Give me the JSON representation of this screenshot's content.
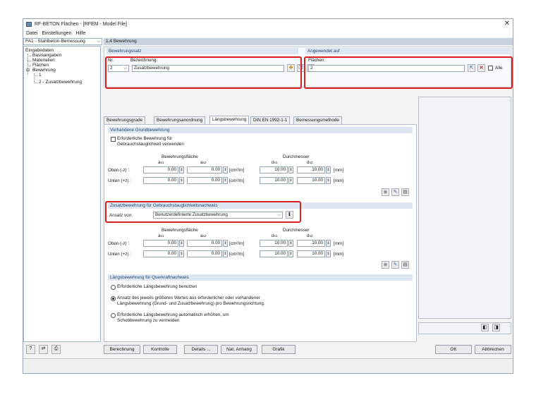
{
  "window": {
    "title": "RF-BETON Flächen - [RFEM - Model File]"
  },
  "menu": [
    "Datei",
    "Einstellungen",
    "Hilfe"
  ],
  "nav": {
    "case": "FA1 - Stahlbeton-Bemessung",
    "items": [
      "Eingabedaten",
      "Basisangaben",
      "Materialien",
      "Flächen",
      "Bewehrung",
      "1",
      "2 - Zusatzbewehrung"
    ]
  },
  "page_title": "1.4 Bewehrung",
  "bewehrungssatz": {
    "title": "Bewehrungssatz",
    "nr_label": "Nr.",
    "nr_value": "2",
    "bez_label": "Bezeichnung:",
    "bez_value": "Zusatzbewehrung"
  },
  "angewendet": {
    "title": "Angewendet auf",
    "flaechen_label": "Flächen:",
    "flaechen_value": "2",
    "alle_label": "Alle"
  },
  "tabs": [
    "Bewehrungsgrade",
    "Bewehrungsanordnung",
    "Längsbewehrung",
    "DIN EN 1992-1-1",
    "Bemessungsmethode"
  ],
  "grundbewehrung": {
    "title": "Vorhandene Grundbewehrung",
    "checkbox_label": [
      "Erforderliche Bewehrung für",
      "Gebrauchstauglichkeit verwenden"
    ],
    "area_header": "Bewehrungsfläche",
    "dia_header": "Durchmesser",
    "a1": "a",
    "a1_sub": "s1",
    "a2": "a",
    "a2_sub": "s2",
    "d1": "d",
    "d1_sub": "s1",
    "d2": "d",
    "d2_sub": "s2",
    "rows": [
      {
        "label": "Oben (-z) :",
        "as1": "0.00",
        "as2": "0.00",
        "unit_area": "[cm²/m]",
        "ds1": "10.00",
        "ds2": "10.00",
        "unit_d": "[mm]"
      },
      {
        "label": "Unten (+z) :",
        "as1": "0.00",
        "as2": "0.00",
        "unit_area": "[cm²/m]",
        "ds1": "10.00",
        "ds2": "10.00",
        "unit_d": "[mm]"
      }
    ]
  },
  "zusatz": {
    "title": "Zusatzbewehrung für Gebrauchstauglichkeitsnachweis",
    "ansatz_label": "Ansatz von:",
    "ansatz_value": "Benutzerdefinierte Zusatzbewehrung",
    "area_header": "Bewehrungsfläche",
    "dia_header": "Durchmesser",
    "a1": "a",
    "a1_sub": "s1",
    "a2": "a",
    "a2_sub": "s2",
    "d1": "d",
    "d1_sub": "s1",
    "d2": "d",
    "d2_sub": "s2",
    "rows": [
      {
        "label": "Oben (-z) :",
        "as1": "0.00",
        "as2": "0.00",
        "unit_area": "[cm²/m]",
        "ds1": "10.00",
        "ds2": "10.00",
        "unit_d": "[mm]"
      },
      {
        "label": "Unten (+z) :",
        "as1": "0.00",
        "as2": "0.00",
        "unit_area": "[cm²/m]",
        "ds1": "10.00",
        "ds2": "10.00",
        "unit_d": "[mm]"
      }
    ]
  },
  "querkraft": {
    "title": "Längsbewehrung für Querkraftnachweis",
    "options": [
      [
        "Erforderliche Längsbewehrung benutzen"
      ],
      [
        "Ansatz des jeweils größeren Wertes aus erforderlicher oder vorhandener",
        "Längsbewehrung (Grund- und Zusatzbewehrung) pro Bewehrungsrichtung."
      ],
      [
        "Erforderliche Längsbewehrung automatisch erhöhen, um",
        "Schubbewehrung zu vermeiden"
      ]
    ],
    "selected_index": 1
  },
  "buttons": {
    "berechnung": "Berechnung",
    "kontrolle": "Kontrolle",
    "details": "Details ...",
    "nat_anhang": "Nat. Anhang",
    "grafik": "Grafik",
    "ok": "OK",
    "abbrechen": "Abbrechen"
  },
  "colors": {
    "accent_red": "#d9201f",
    "header_blue": "#dde6f1"
  }
}
